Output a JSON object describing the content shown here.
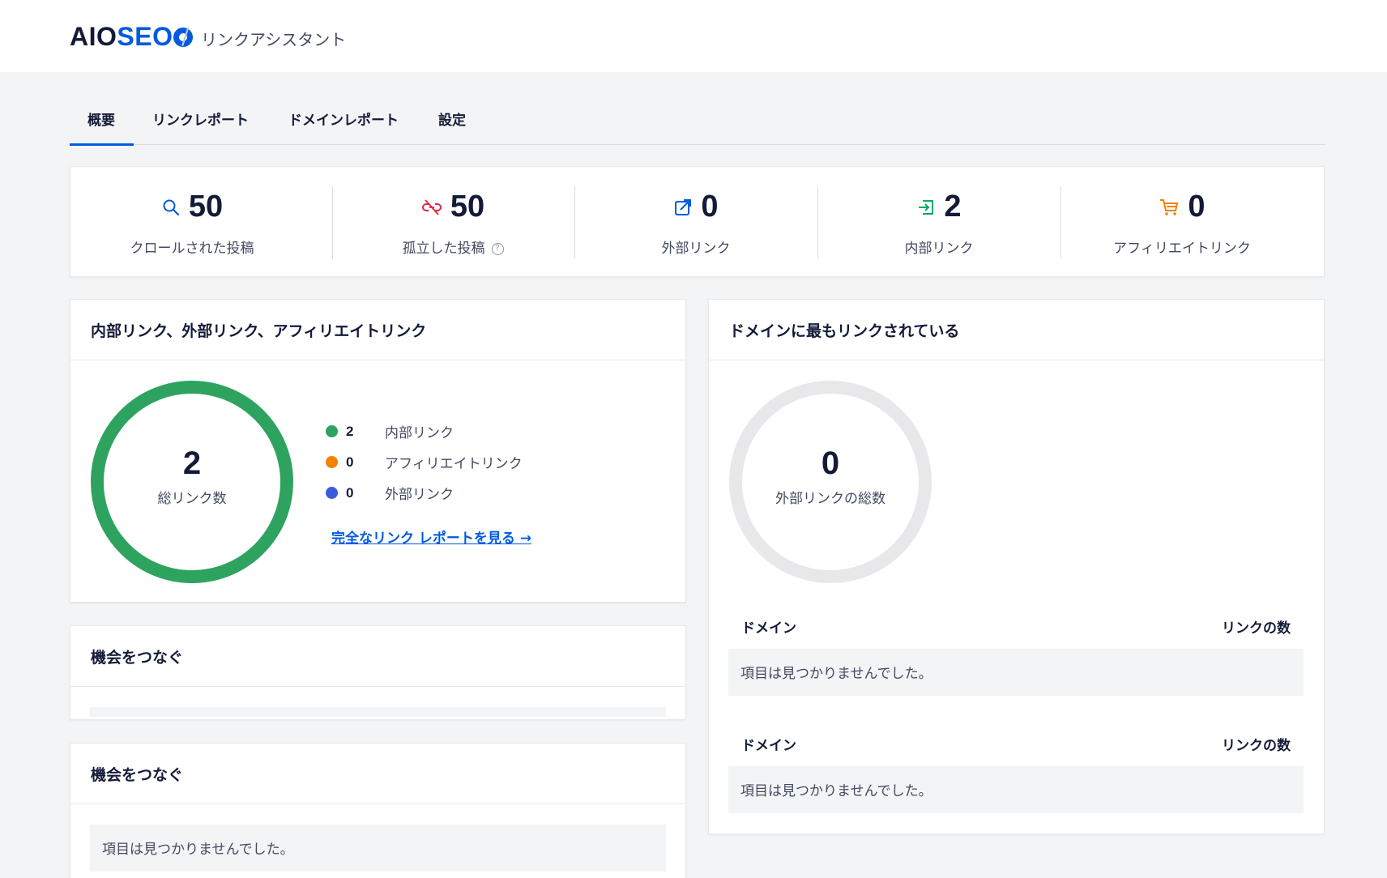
{
  "header": {
    "logo_prefix": "AIO",
    "logo_seo": "SEO",
    "breadcrumb_separator": "/",
    "breadcrumb": "リンクアシスタント"
  },
  "tabs": [
    {
      "label": "概要",
      "active": true
    },
    {
      "label": "リンクレポート",
      "active": false
    },
    {
      "label": "ドメインレポート",
      "active": false
    },
    {
      "label": "設定",
      "active": false
    }
  ],
  "stats": [
    {
      "icon": "search-icon",
      "value": "50",
      "label": "クロールされた投稿",
      "color": "#005ae0"
    },
    {
      "icon": "broken-link-icon",
      "value": "50",
      "label": "孤立した投稿",
      "color": "#df2a4a",
      "help": "?"
    },
    {
      "icon": "external-link-icon",
      "value": "0",
      "label": "外部リンク",
      "color": "#005ae0"
    },
    {
      "icon": "internal-link-icon",
      "value": "2",
      "label": "内部リンク",
      "color": "#00aa63"
    },
    {
      "icon": "cart-icon",
      "value": "0",
      "label": "アフィリエイトリンク",
      "color": "#f18200"
    }
  ],
  "links_card": {
    "title": "内部リンク、外部リンク、アフィリエイトリンク",
    "total": "2",
    "total_label": "総リンク数",
    "legend": [
      {
        "value": "2",
        "label": "内部リンク",
        "color": "#2ea35f"
      },
      {
        "value": "0",
        "label": "アフィリエイトリンク",
        "color": "#f18200"
      },
      {
        "value": "0",
        "label": "外部リンク",
        "color": "#3b5bdb"
      }
    ],
    "report_link": "完全なリンク レポートを見る →"
  },
  "connect_card_1": {
    "title": "機会をつなぐ"
  },
  "connect_card_2": {
    "title": "機会をつなぐ",
    "empty": "項目は見つかりませんでした。"
  },
  "domain_card": {
    "title": "ドメインに最もリンクされている",
    "total": "0",
    "total_label": "外部リンクの総数",
    "table_1": {
      "col_domain": "ドメイン",
      "col_links": "リンクの数",
      "empty": "項目は見つかりませんでした。"
    },
    "table_2": {
      "col_domain": "ドメイン",
      "col_links": "リンクの数",
      "empty": "項目は見つかりませんでした。"
    }
  },
  "colors": {
    "accent": "#005ae0",
    "donut_green": "#2ea35f",
    "donut_empty": "#e8e8eb"
  }
}
